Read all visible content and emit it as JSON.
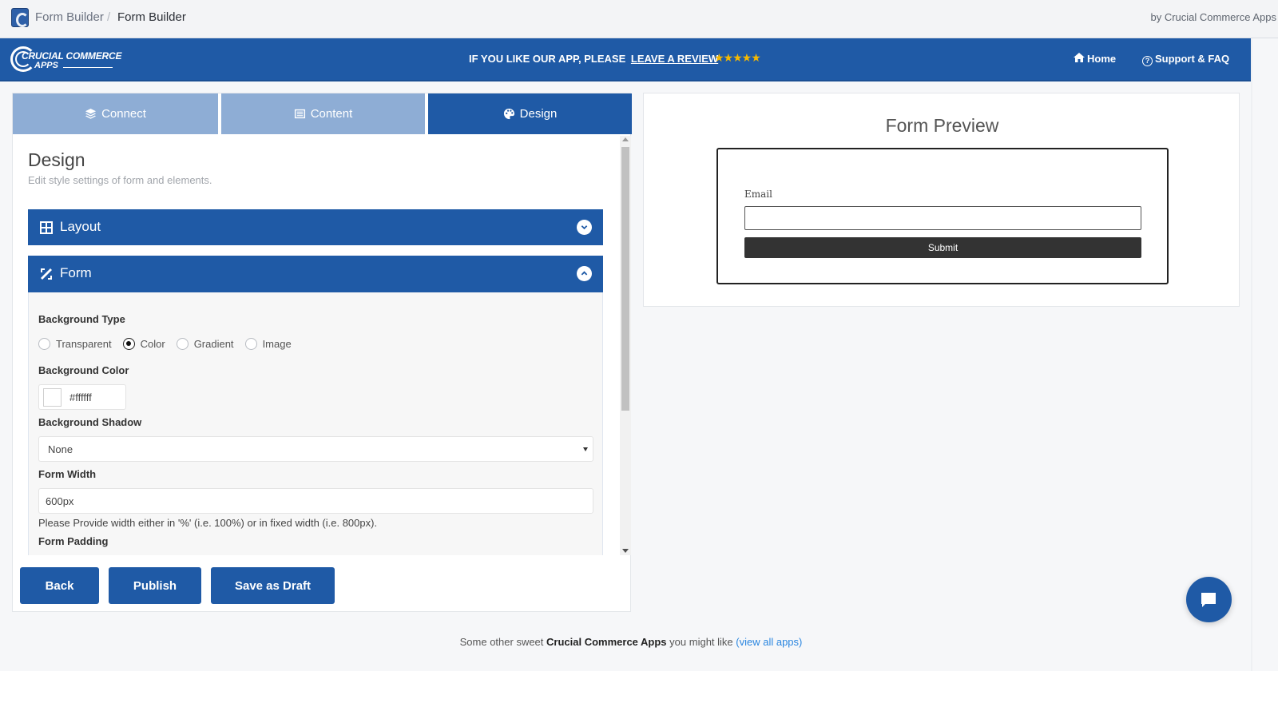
{
  "admin_bar": {
    "breadcrumb": [
      "Form Builder",
      "Form Builder"
    ],
    "separator": "/",
    "vendor": "by Crucial Commerce Apps"
  },
  "header": {
    "logo_line1": "CRUCIAL COMMERCE",
    "logo_line2": "APPS",
    "promo_text": "IF YOU LIKE OUR APP, PLEASE",
    "promo_link": "LEAVE A REVIEW",
    "stars": "★★★★★",
    "rating_stars": 5,
    "nav": [
      {
        "label": "Home",
        "icon": "home-icon"
      },
      {
        "label": "Support & FAQ",
        "icon": "help-circle-icon"
      }
    ],
    "colors": {
      "brand": "#1f5aa6",
      "star": "#f5b800"
    }
  },
  "tabs": [
    {
      "label": "Connect",
      "icon": "layers-icon",
      "active": false
    },
    {
      "label": "Content",
      "icon": "list-icon",
      "active": false
    },
    {
      "label": "Design",
      "icon": "palette-icon",
      "active": true
    }
  ],
  "design": {
    "title": "Design",
    "subtitle": "Edit style settings of form and elements.",
    "sections": [
      {
        "label": "Layout",
        "icon": "grid-icon",
        "expanded": false
      },
      {
        "label": "Form",
        "icon": "tools-icon",
        "expanded": true
      }
    ],
    "form_settings": {
      "background_type_label": "Background Type",
      "background_type_options": [
        "Transparent",
        "Color",
        "Gradient",
        "Image"
      ],
      "background_type_selected": "Color",
      "background_color_label": "Background Color",
      "background_color_value": "#ffffff",
      "background_shadow_label": "Background Shadow",
      "background_shadow_value": "None",
      "form_width_label": "Form Width",
      "form_width_value": "600px",
      "form_width_help": "Please Provide width either in '%' (i.e. 100%) or in fixed width (i.e. 800px).",
      "form_padding_label": "Form Padding"
    }
  },
  "actions": {
    "back": "Back",
    "publish": "Publish",
    "save_draft": "Save as Draft"
  },
  "preview": {
    "title": "Form Preview",
    "email_label": "Email",
    "submit_label": "Submit"
  },
  "footer": {
    "prefix": "Some other sweet",
    "brand": "Crucial Commerce Apps",
    "suffix": "you might like",
    "link": "(view all apps)"
  }
}
